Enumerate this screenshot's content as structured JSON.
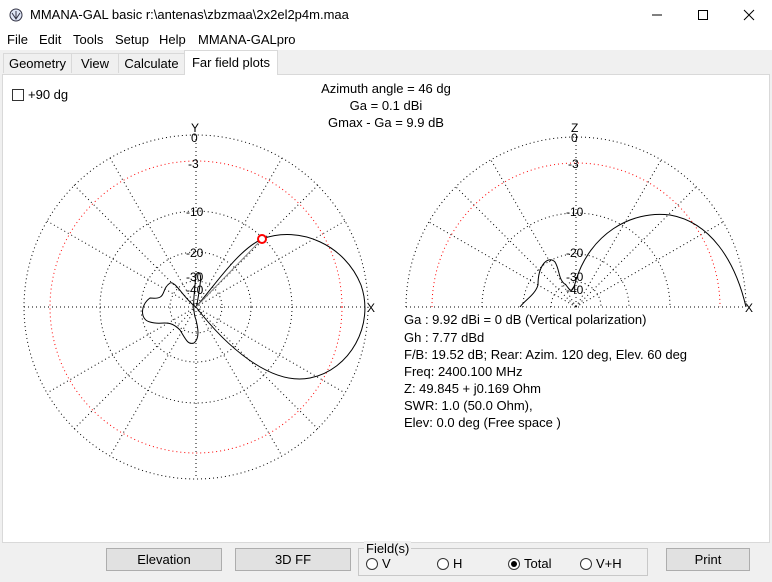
{
  "window": {
    "title": "MMANA-GAL basic r:\\antenas\\zbzmaa\\2x2el2p4m.maa",
    "icons": [
      "app-icon",
      "minimize-icon",
      "maximize-icon",
      "close-icon"
    ]
  },
  "menu": [
    "File",
    "Edit",
    "Tools",
    "Setup",
    "Help",
    "MMANA-GALpro"
  ],
  "tabs": [
    "Geometry",
    "View",
    "Calculate",
    "Far field plots"
  ],
  "active_tab": "Far field plots",
  "plot": {
    "checkbox_label": "+90 dg",
    "azimuth": "Azimuth angle = 46 dg",
    "ga": "Ga = 0.1 dBi",
    "gmax": "Gmax - Ga = 9.9 dB",
    "left_axes": {
      "top": "Y",
      "right": "X"
    },
    "right_axes": {
      "top": "Z",
      "right": "X"
    },
    "ring_labels": [
      "0",
      "-3",
      "-10",
      "-20",
      "-30",
      "-40"
    ],
    "ring_labels_right": [
      "0",
      "-3",
      "-10",
      "-20",
      "-30",
      "-40"
    ],
    "colors": {
      "pattern": "#000000",
      "dotted_grid": "#000000",
      "minus3_ring": "#ff0000",
      "marker": "#ff0000"
    }
  },
  "info": {
    "line1": "Ga : 9.92 dBi = 0 dB  (Vertical polarization)",
    "line2": "Gh : 7.77 dBd",
    "line3": "F/B: 19.52 dB; Rear: Azim. 120 deg,  Elev. 60 deg",
    "line4": "Freq: 2400.100 MHz",
    "line5": "Z: 49.845 + j0.169 Ohm",
    "line6": "SWR: 1.0 (50.0 Ohm),",
    "line7": "Elev: 0.0 deg (Free space )"
  },
  "buttons": {
    "elevation": "Elevation",
    "ff3d": "3D FF",
    "print": "Print"
  },
  "fields": {
    "legend": "Field(s)",
    "options": [
      "V",
      "H",
      "Total",
      "V+H"
    ],
    "selected": "Total"
  }
}
